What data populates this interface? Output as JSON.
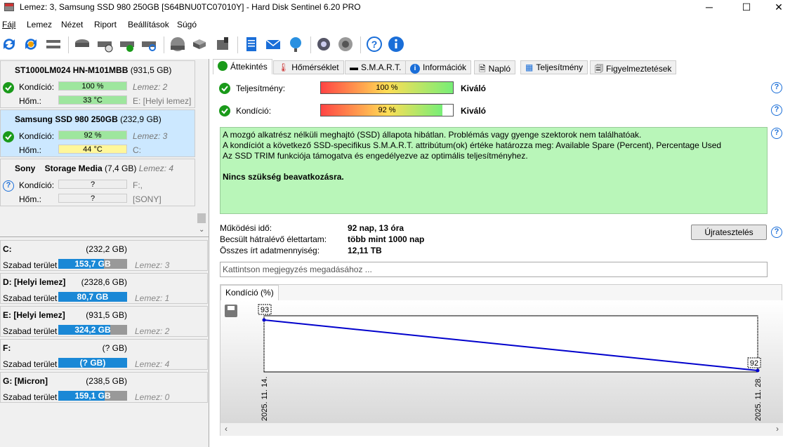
{
  "window": {
    "title": "Lemez: 3, Samsung SSD 980 250GB [S64BNU0TC07010Y]  -  Hard Disk Sentinel 6.20 PRO",
    "min": "─",
    "max": "☐",
    "close": "✕"
  },
  "menu": [
    "Fájl",
    "Lemez",
    "Nézet",
    "Riport",
    "Beállítások",
    "Súgó"
  ],
  "disks": [
    {
      "name": "ST1000LM024 HN-M101MBB",
      "size": "(931,5 GB)",
      "cond_label": "Kondíció:",
      "cond": "100 %",
      "cond_frac": 1.0,
      "temp_label": "Hőm.:",
      "temp": "33 °C",
      "ext1": "Lemez: 2",
      "ext2": "E: [Helyi lemez]",
      "status": "ok"
    },
    {
      "name": "Samsung SSD 980 250GB",
      "size": "(232,9 GB)",
      "cond_label": "Kondíció:",
      "cond": "92 %",
      "cond_frac": 0.92,
      "temp_label": "Hőm.:",
      "temp": "44 °C",
      "ext1": "Lemez: 3",
      "ext2": "C:",
      "status": "ok"
    },
    {
      "name": "Sony    Storage Media",
      "size": "(7,4 GB)",
      "cond_label": "Kondíció:",
      "cond": "?",
      "cond_frac": 0,
      "temp_label": "Hőm.:",
      "temp": "?",
      "ext1": "Lemez: 4",
      "ext2": "F:,",
      "ext3": "[SONY]",
      "status": "unknown"
    }
  ],
  "partitions": [
    {
      "name": "C:",
      "size": "(232,2 GB)",
      "free_label": "Szabad terület",
      "free": "153,7 GB",
      "free_frac": 0.66,
      "disk": "Lemez: 3"
    },
    {
      "name": "D: [Helyi lemez]",
      "size": "(2328,6 GB)",
      "free_label": "Szabad terület",
      "free": "80,7 GB",
      "free_frac": 1.0,
      "disk": "Lemez: 1"
    },
    {
      "name": "E: [Helyi lemez]",
      "size": "(931,5 GB)",
      "free_label": "Szabad terület",
      "free": "324,2 GB",
      "free_frac": 0.75,
      "disk": "Lemez: 2"
    },
    {
      "name": "F:",
      "size": "(? GB)",
      "free_label": "Szabad terület",
      "free": "(? GB)",
      "free_frac": 1.0,
      "disk": "Lemez: 4"
    },
    {
      "name": "G: [Micron]",
      "size": "(238,5 GB)",
      "free_label": "Szabad terület",
      "free": "159,1 GB",
      "free_frac": 0.67,
      "disk": "Lemez: 0"
    }
  ],
  "tabs": [
    "Áttekintés",
    "Hőmérséklet",
    "S.M.A.R.T.",
    "Információk",
    "Napló",
    "Teljesítmény",
    "Figyelmeztetések"
  ],
  "overview": {
    "perf_label": "Teljesítmény:",
    "perf": "100 %",
    "perf_frac": 1.0,
    "perf_rating": "Kiváló",
    "cond_label": "Kondíció:",
    "cond": "92 %",
    "cond_frac": 0.92,
    "cond_rating": "Kiváló",
    "msg_lines": [
      "A mozgó alkatrész nélküli meghajtó (SSD) állapota hibátlan. Problémás vagy gyenge szektorok nem találhatóak.",
      "A kondíciót a következő SSD-specifikus S.M.A.R.T. attribútum(ok) értéke határozza meg:  Available Spare (Percent), Percentage Used",
      "Az SSD TRIM funkciója támogatva és engedélyezve az optimális teljesítményhez."
    ],
    "msg_bold": "Nincs szükség beavatkozásra.",
    "uptime_label": "Működési idő:",
    "uptime": "92 nap, 13 óra",
    "life_label": "Becsült hátralévő élettartam:",
    "life": "több mint 1000 nap",
    "written_label": "Összes írt adatmennyiség:",
    "written": "12,11 TB",
    "retest": "Újratesztelés",
    "note_placeholder": "Kattintson megjegyzés megadásához ..."
  },
  "chart_tab": "Kondíció  (%)",
  "chart_data": {
    "type": "line",
    "x": [
      "2025. 11. 14.",
      "2025. 11. 28."
    ],
    "values": [
      93,
      92
    ],
    "ylim": [
      92,
      93
    ]
  }
}
